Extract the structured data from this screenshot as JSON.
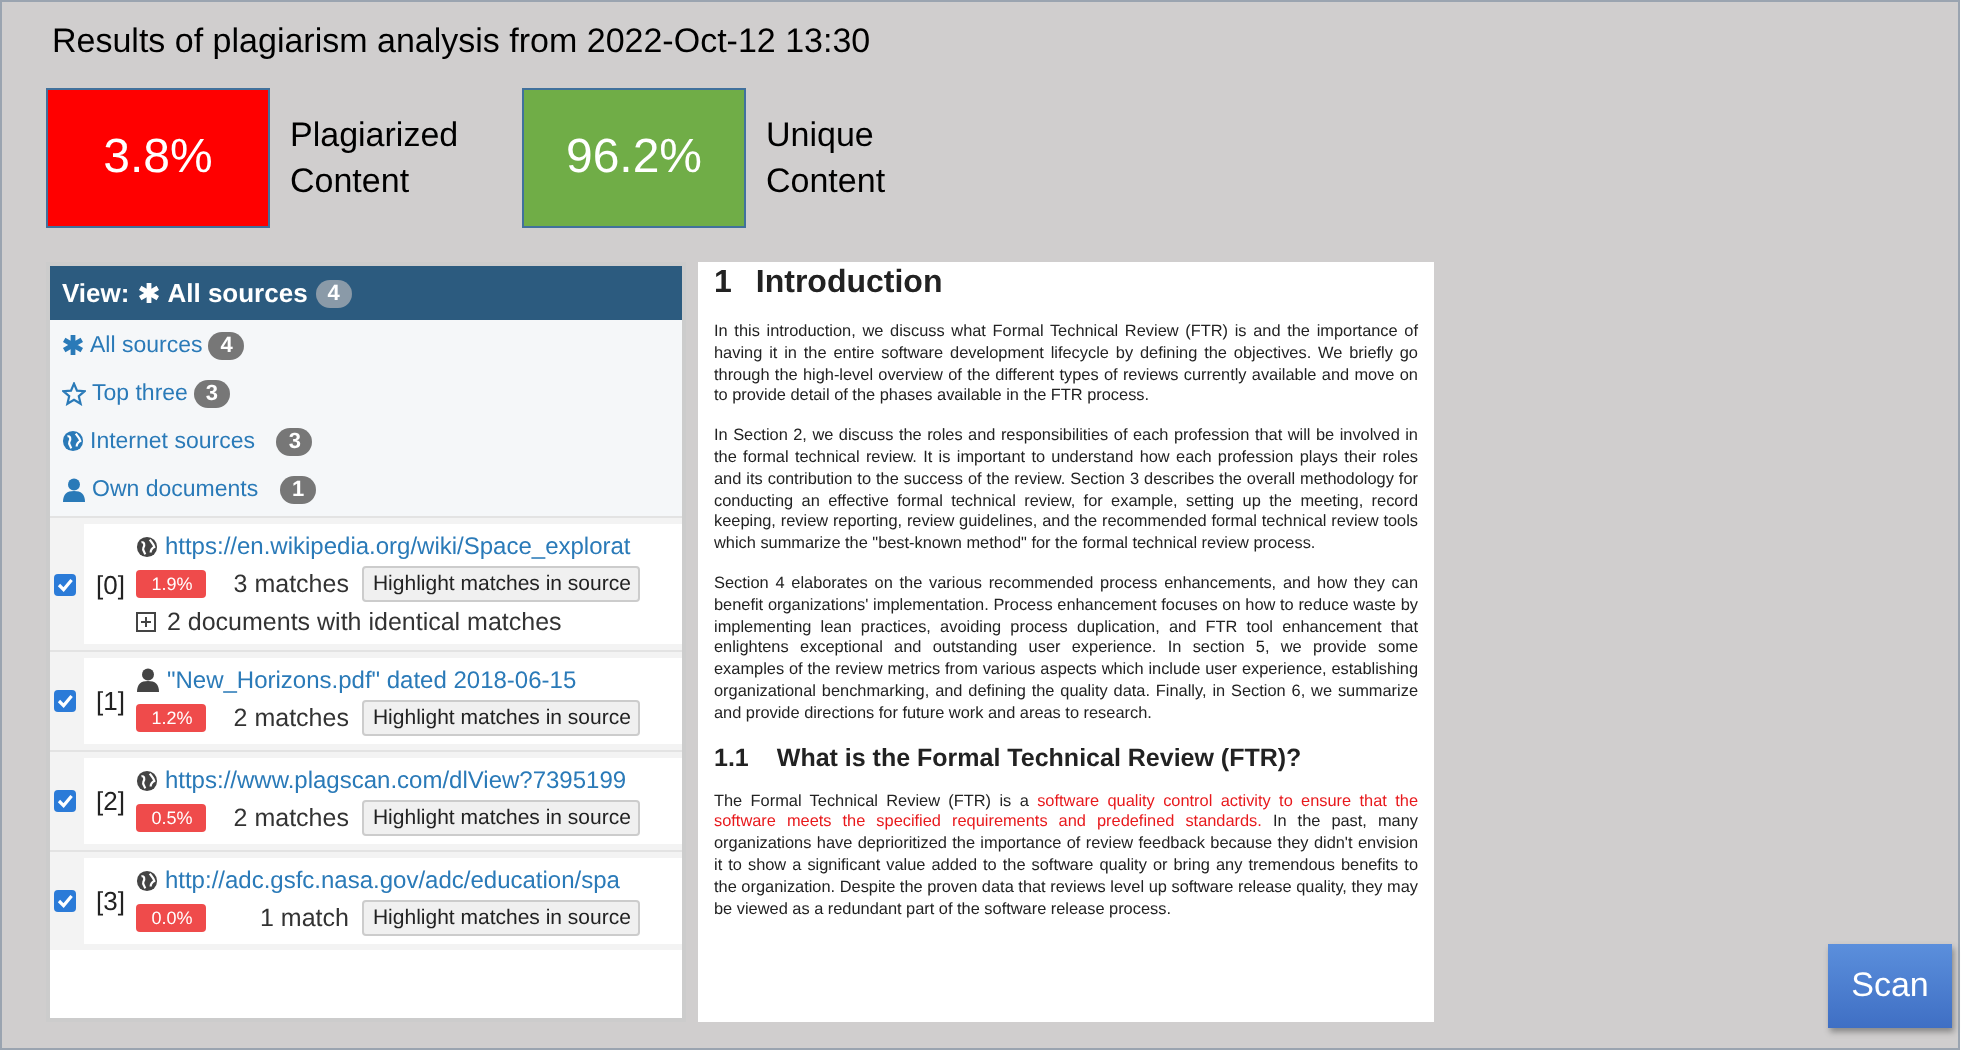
{
  "title": "Results of plagiarism analysis from 2022-Oct-12 13:30",
  "scores": [
    {
      "value": "3.8%",
      "label": "Plagiarized Content",
      "color": "#ff0000"
    },
    {
      "value": "96.2%",
      "label": "Unique Content",
      "color": "#70ad47"
    }
  ],
  "view": {
    "prefix": "View:",
    "kind": "asterisk",
    "label": "All sources",
    "count": "4"
  },
  "filters": [
    {
      "kind": "asterisk",
      "label": "All sources",
      "count": "4"
    },
    {
      "kind": "star",
      "label": "Top three",
      "count": "3"
    },
    {
      "kind": "globe",
      "label": "Internet sources",
      "count": "3"
    },
    {
      "kind": "person",
      "label": "Own documents",
      "count": "1"
    }
  ],
  "sources": [
    {
      "kind": "web",
      "checked": true,
      "index": "[0]",
      "link": "https://en.wikipedia.org/wiki/Space_explorat",
      "percent": "1.9%",
      "matches": "3 matches",
      "button": "Highlight matches in source",
      "identical": "2 documents with identical matches"
    },
    {
      "kind": "document",
      "checked": true,
      "index": "[1]",
      "link": "\"New_Horizons.pdf\" dated 2018-06-15",
      "percent": "1.2%",
      "matches": "2 matches",
      "button": "Highlight matches in source"
    },
    {
      "kind": "web",
      "checked": true,
      "index": "[2]",
      "link": "https://www.plagscan.com/dlView?7395199",
      "percent": "0.5%",
      "matches": "2 matches",
      "button": "Highlight matches in source"
    },
    {
      "kind": "web",
      "checked": true,
      "index": "[3]",
      "link": "http://adc.gsfc.nasa.gov/adc/education/spa",
      "percent": "0.0%",
      "matches": "1 match",
      "button": "Highlight matches in source"
    }
  ],
  "document": [
    {
      "kind": "heading",
      "number": "1",
      "text": "Introduction"
    },
    {
      "kind": "paragraph",
      "segments": [
        {
          "text": "In this introduction, we discuss what Formal Technical Review (FTR) is and the importance of having it in the entire software development lifecycle by defining the objectives. We briefly go through the high-level overview of the different types of reviews currently available and move on to provide detail of the phases available in the FTR process.",
          "highlighted": false
        }
      ]
    },
    {
      "kind": "paragraph",
      "segments": [
        {
          "text": "In Section 2, we discuss the roles and responsibilities of each profession that will be involved in the formal technical review. It is important to understand how each profession plays their roles and its contribution to the success of the review. Section 3 describes the overall methodology for conducting an effective formal technical review, for example, setting up the meeting, record keeping, review reporting, review guidelines, and the recommended formal technical review tools which summarize the \"best-known method\" for the formal technical review process.",
          "highlighted": false
        }
      ]
    },
    {
      "kind": "paragraph",
      "segments": [
        {
          "text": "Section 4 elaborates on the various recommended process enhancements, and how they can benefit organizations' implementation. Process enhancement focuses on how to reduce waste by implementing lean practices, avoiding process duplication, and FTR tool enhancement that enlightens exceptional and outstanding user experience. In section 5, we provide some examples of the review metrics from various aspects which include user experience, establishing organizational benchmarking, and defining the quality data. Finally, in Section 6, we summarize and provide directions for future work and areas to research.",
          "highlighted": false
        }
      ]
    },
    {
      "kind": "subheading",
      "number": "1.1",
      "text": "What is the Formal Technical Review (FTR)?"
    },
    {
      "kind": "paragraph",
      "segments": [
        {
          "text": "The Formal Technical Review (FTR) is a ",
          "highlighted": false
        },
        {
          "text": "software quality control activity to ensure that the software meets the specified requirements and predefined standards.",
          "highlighted": true
        },
        {
          "text": " In the past, many organizations have deprioritized the importance of review feedback because they didn't envision it to show a significant value added to the software quality or bring any tremendous benefits to the organization. Despite the proven data that reviews level up software release quality, they may be viewed as a redundant part of the software release process.",
          "highlighted": false
        }
      ]
    }
  ],
  "scan_button": "Scan"
}
